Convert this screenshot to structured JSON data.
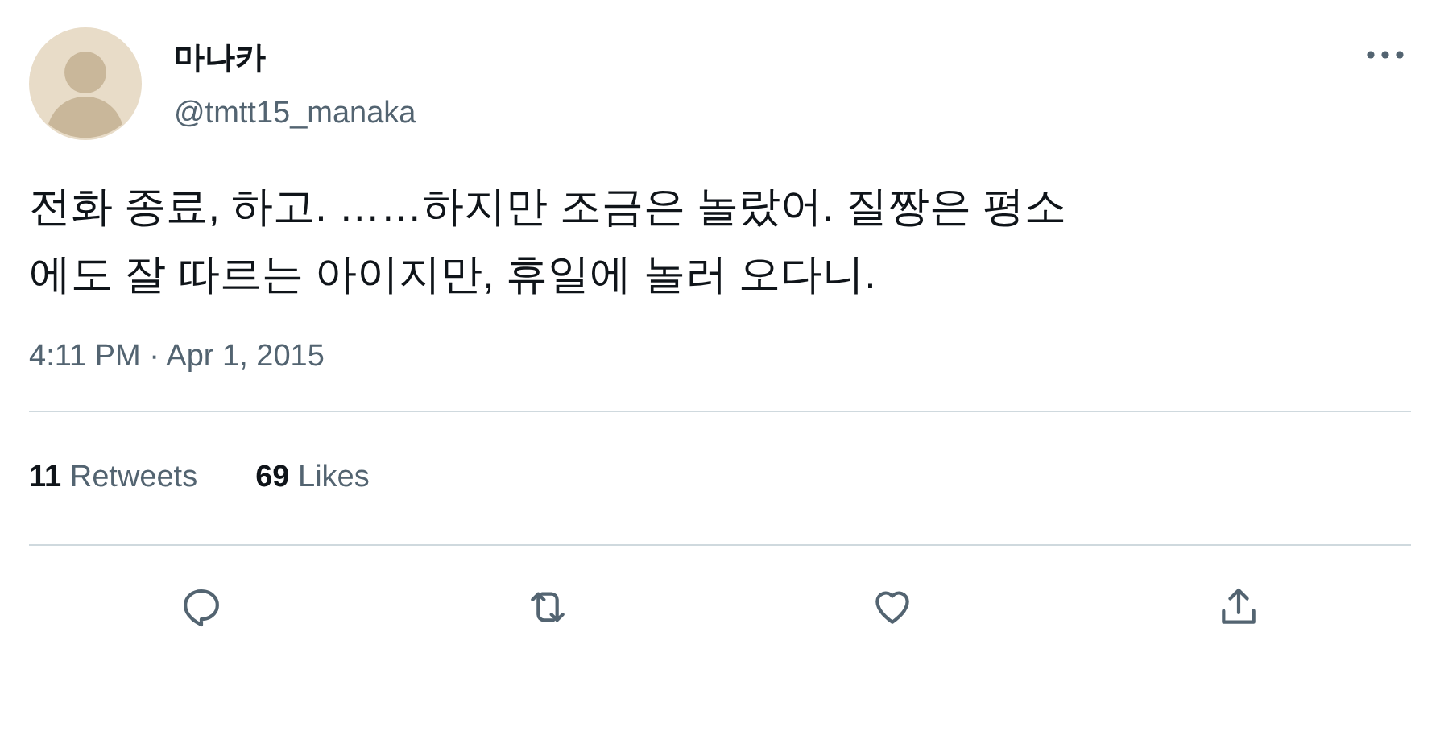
{
  "author": {
    "name": "마나카",
    "handle": "@tmtt15_manaka"
  },
  "tweet": {
    "lines": [
      "전화 종료, 하고. ……하지만 조금은 놀랐어. 질짱은 평소",
      "에도 잘 따르는 아이지만, 휴일에 놀러 오다니."
    ]
  },
  "timestamp": "4:11 PM · Apr 1, 2015",
  "stats": [
    {
      "count": "11",
      "label": "Retweets"
    },
    {
      "count": "69",
      "label": "Likes"
    }
  ],
  "actions": [
    {
      "kind": "reply"
    },
    {
      "kind": "retweet"
    },
    {
      "kind": "like"
    },
    {
      "kind": "share"
    }
  ]
}
